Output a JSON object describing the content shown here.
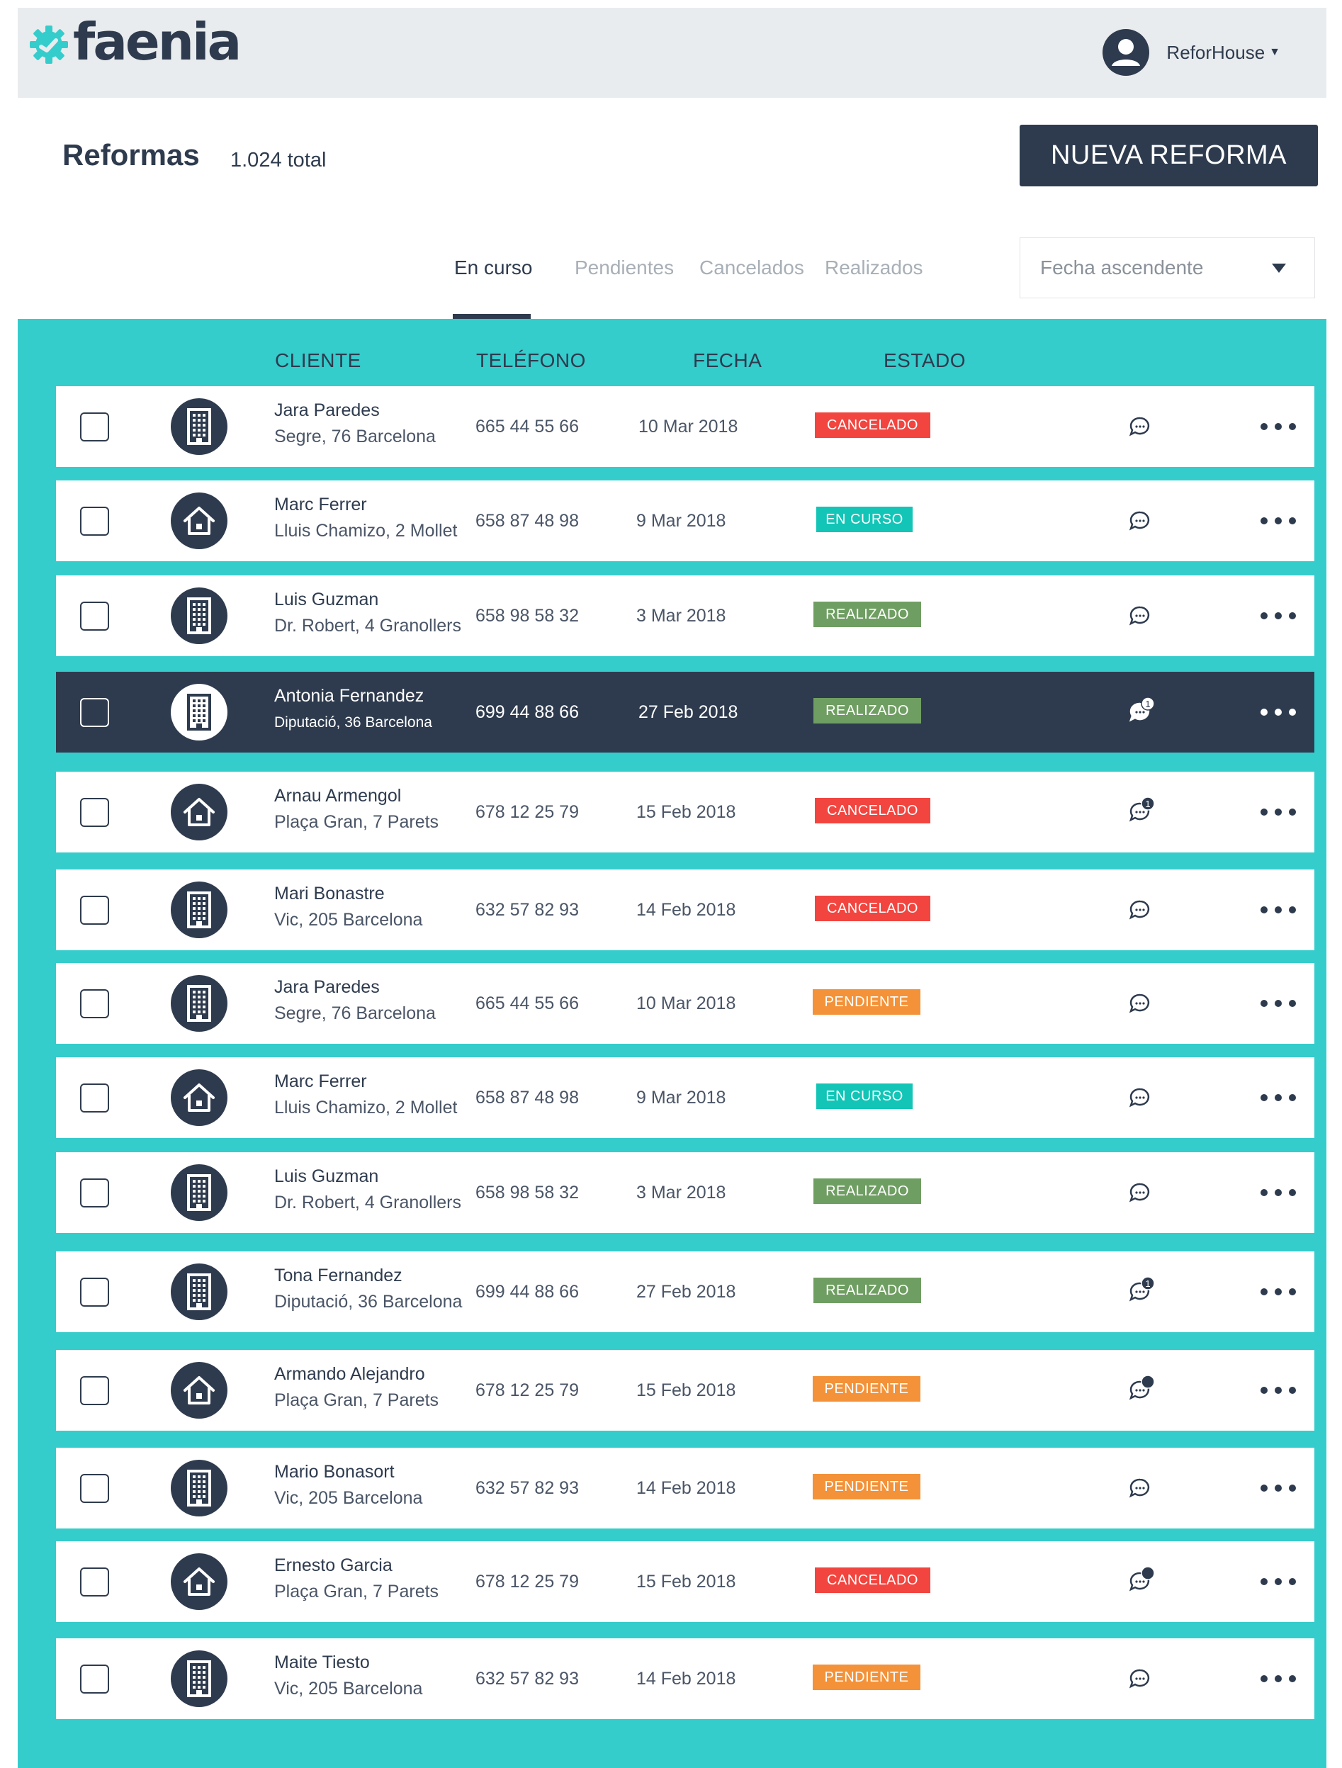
{
  "header": {
    "logo_text": "faenia",
    "user_name": "ReforHouse"
  },
  "page": {
    "title": "Reformas",
    "total": "1.024 total",
    "new_button": "NUEVA REFORMA"
  },
  "tabs": [
    {
      "label": "En curso",
      "active": true
    },
    {
      "label": "Pendientes",
      "active": false
    },
    {
      "label": "Cancelados",
      "active": false
    },
    {
      "label": "Realizados",
      "active": false
    }
  ],
  "sort": {
    "label": "Fecha ascendente"
  },
  "table": {
    "headers": [
      "CLIENTE",
      "TELÉFONO",
      "FECHA",
      "ESTADO"
    ],
    "rows": [
      {
        "name": "Jara Paredes",
        "address": "Segre, 76 Barcelona",
        "phone": "665 44 55 66",
        "date": "10 Mar 2018",
        "status": "CANCELADO",
        "type": "building",
        "chat": "none"
      },
      {
        "name": "Marc Ferrer",
        "address": "Lluis Chamizo, 2 Mollet",
        "phone": "658 87 48 98",
        "date": "9 Mar 2018",
        "status": "EN CURSO",
        "type": "house",
        "chat": "none"
      },
      {
        "name": "Luis Guzman",
        "address": "Dr. Robert, 4 Granollers",
        "phone": "658 98 58 32",
        "date": "3 Mar 2018",
        "status": "REALIZADO",
        "type": "building",
        "chat": "none"
      },
      {
        "name": "Antonia Fernandez",
        "address": "Diputació, 36 Barcelona",
        "phone": "699 44 88 66",
        "date": "27 Feb 2018",
        "status": "REALIZADO",
        "type": "building",
        "chat": "1",
        "selected": true
      },
      {
        "name": "Arnau Armengol",
        "address": "Plaça Gran, 7 Parets",
        "phone": "678 12 25 79",
        "date": "15 Feb 2018",
        "status": "CANCELADO",
        "type": "house",
        "chat": "1"
      },
      {
        "name": "Mari Bonastre",
        "address": "Vic, 205 Barcelona",
        "phone": "632 57 82 93",
        "date": "14 Feb 2018",
        "status": "CANCELADO",
        "type": "building",
        "chat": "none"
      },
      {
        "name": "Jara Paredes",
        "address": "Segre, 76 Barcelona",
        "phone": "665 44 55 66",
        "date": "10 Mar 2018",
        "status": "PENDIENTE",
        "type": "building",
        "chat": "none"
      },
      {
        "name": "Marc Ferrer",
        "address": "Lluis Chamizo, 2 Mollet",
        "phone": "658 87 48 98",
        "date": "9 Mar 2018",
        "status": "EN CURSO",
        "type": "house",
        "chat": "none"
      },
      {
        "name": "Luis Guzman",
        "address": "Dr. Robert, 4 Granollers",
        "phone": "658 98 58 32",
        "date": "3 Mar 2018",
        "status": "REALIZADO",
        "type": "building",
        "chat": "none"
      },
      {
        "name": "Tona Fernandez",
        "address": "Diputació, 36 Barcelona",
        "phone": "699 44 88 66",
        "date": "27 Feb 2018",
        "status": "REALIZADO",
        "type": "building",
        "chat": "1"
      },
      {
        "name": "Armando Alejandro",
        "address": "Plaça Gran, 7 Parets",
        "phone": "678 12 25 79",
        "date": "15 Feb 2018",
        "status": "PENDIENTE",
        "type": "house",
        "chat": "dot"
      },
      {
        "name": "Mario Bonasort",
        "address": "Vic, 205 Barcelona",
        "phone": "632 57 82 93",
        "date": "14 Feb 2018",
        "status": "PENDIENTE",
        "type": "building",
        "chat": "none"
      },
      {
        "name": "Ernesto Garcia",
        "address": "Plaça Gran, 7 Parets",
        "phone": "678 12 25 79",
        "date": "15 Feb 2018",
        "status": "CANCELADO",
        "type": "house",
        "chat": "dot"
      },
      {
        "name": "Maite Tiesto",
        "address": "Vic, 205 Barcelona",
        "phone": "632 57 82 93",
        "date": "14 Feb 2018",
        "status": "PENDIENTE",
        "type": "building",
        "chat": "none"
      }
    ]
  },
  "colors": {
    "primary": "#2e3b4e",
    "teal": "#35cccc",
    "cancelado": "#f2453f",
    "en_curso": "#12c5b6",
    "realizado": "#6f9e62",
    "pendiente": "#f39238"
  }
}
